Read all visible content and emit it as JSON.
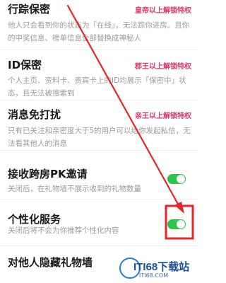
{
  "settings": [
    {
      "title": "行踪保密",
      "badge": "皇帝以上解锁特权",
      "badge_color": "#e0366a",
      "desc": "他人只会看到你的状态为「在线」，无法踪你进房。且你的中奖信息、榜单信息全部替换成神秘人"
    },
    {
      "title": "ID保密",
      "badge": "郡王以上解锁特权",
      "badge_color": "#e0366a",
      "desc": "个人主页、资料卡、贵宾卡上的ID均展示「保密中」状态，且无法被搜索到"
    },
    {
      "title": "消息免打扰",
      "badge": "亲王以上解锁特权",
      "badge_color": "#e0366a",
      "desc": "只有已关注和亲密度大于5的用户可以给你发起私信，无法看其他人的消息"
    },
    {
      "title": "接收跨房PK邀请",
      "desc": "关闭后，在礼物墙不展示收到的礼物数量",
      "toggle_on": true
    },
    {
      "title": "个性化服务",
      "desc": "关闭后将不会为你推荐个性化内容",
      "toggle_on": true
    },
    {
      "title": "对他人隐藏礼物墙"
    }
  ],
  "watermark": {
    "text": "ITI68下载站",
    "sub": "ITI68.COM"
  },
  "accent": {
    "toggle": "#2cc44a",
    "arrow": "#e8262a"
  }
}
